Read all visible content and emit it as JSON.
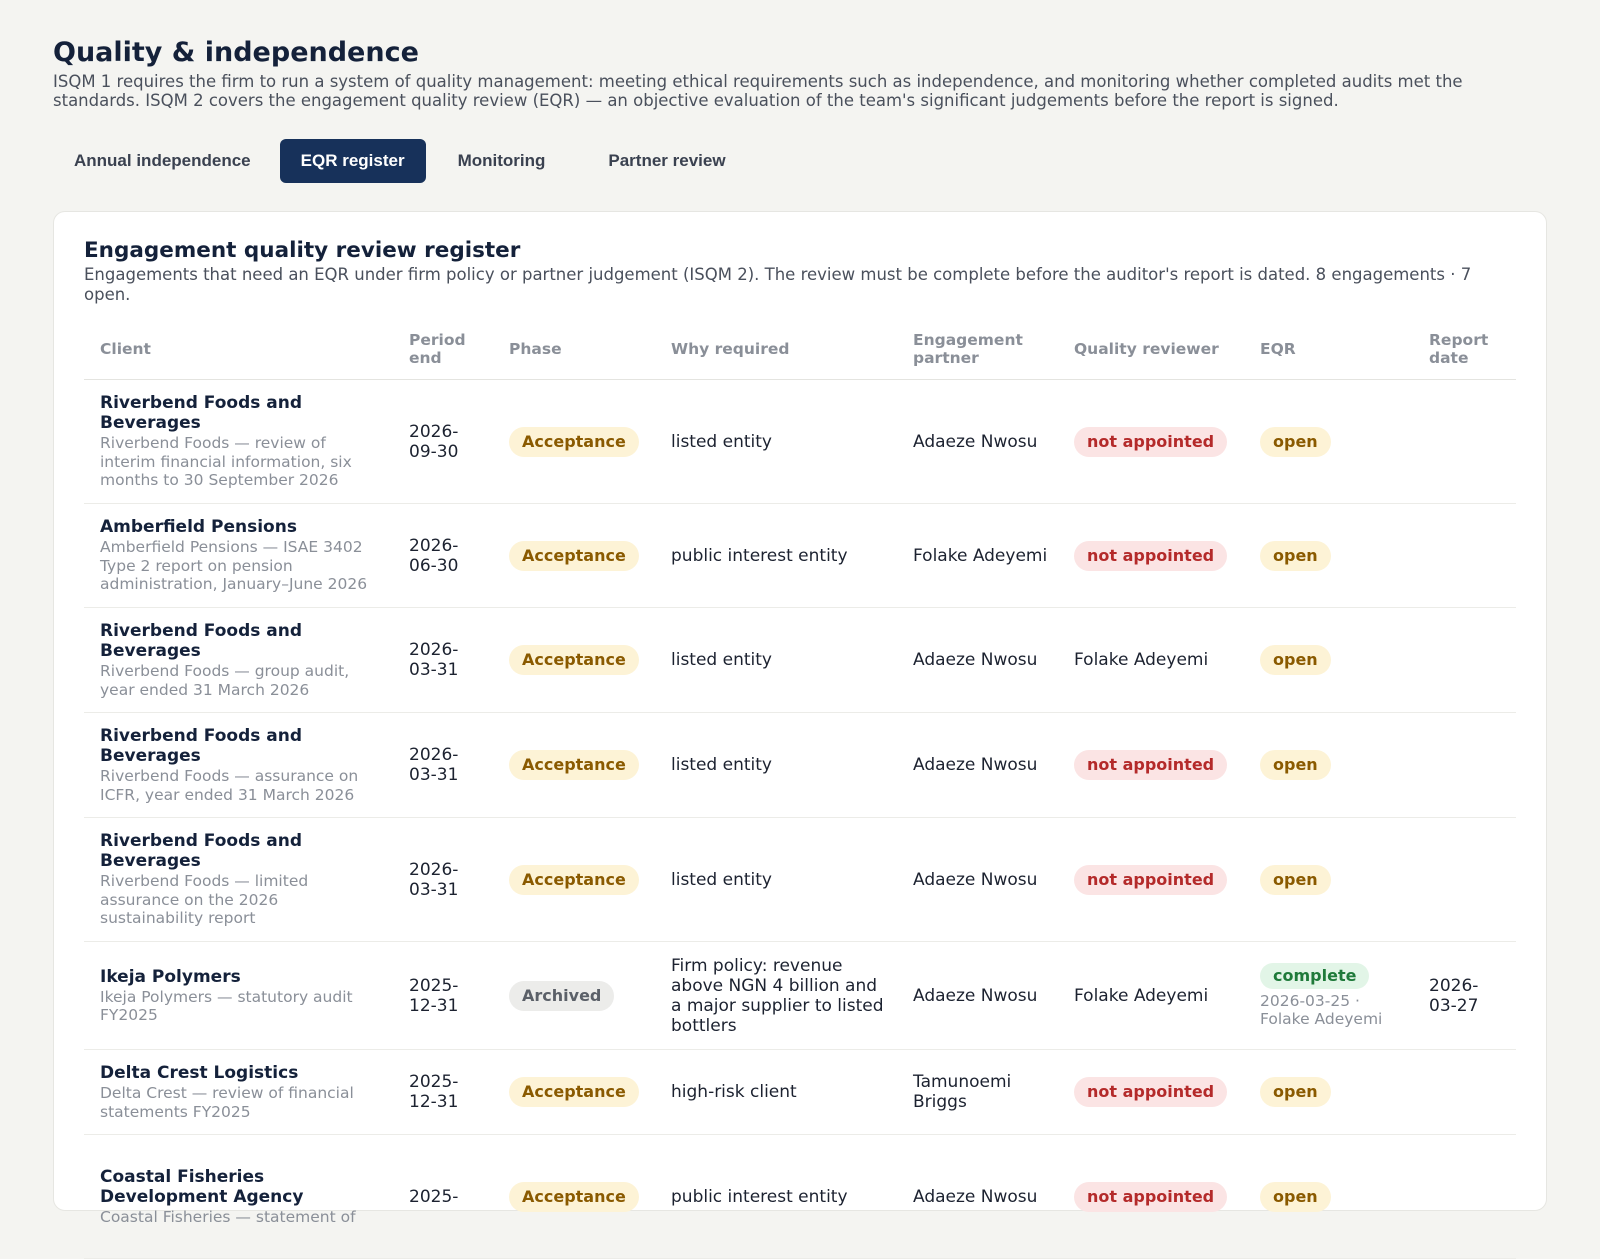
{
  "header": {
    "title": "Quality & independence",
    "description": "ISQM 1 requires the firm to run a system of quality management: meeting ethical requirements such as independence, and monitoring whether completed audits met the standards. ISQM 2 covers the engagement quality review (EQR) — an objective evaluation of the team's significant judgements before the report is signed."
  },
  "tabs": [
    {
      "label": "Annual independence",
      "active": false
    },
    {
      "label": "EQR register",
      "active": true
    },
    {
      "label": "Monitoring",
      "active": false
    },
    {
      "label": "Partner review",
      "active": false
    }
  ],
  "register": {
    "title": "Engagement quality review register",
    "description": "Engagements that need an EQR under firm policy or partner judgement (ISQM 2). The review must be complete before the auditor's report is dated. 8 engagements · 7 open.",
    "columns": [
      "Client",
      "Period end",
      "Phase",
      "Why required",
      "Engagement partner",
      "Quality reviewer",
      "EQR",
      "Report date"
    ],
    "rows": [
      {
        "client": "Riverbend Foods and Beverages",
        "engagement": "Riverbend Foods — review of interim financial information, six months to 30 September 2026",
        "period_end": "2026-09-30",
        "phase": "Acceptance",
        "why": "listed entity",
        "partner": "Adaeze Nwosu",
        "reviewer": "not appointed",
        "eqr": "open",
        "eqr_detail": "",
        "report_date": ""
      },
      {
        "client": "Amberfield Pensions",
        "engagement": "Amberfield Pensions — ISAE 3402 Type 2 report on pension administration, January–June 2026",
        "period_end": "2026-06-30",
        "phase": "Acceptance",
        "why": "public interest entity",
        "partner": "Folake Adeyemi",
        "reviewer": "not appointed",
        "eqr": "open",
        "eqr_detail": "",
        "report_date": ""
      },
      {
        "client": "Riverbend Foods and Beverages",
        "engagement": "Riverbend Foods — group audit, year ended 31 March 2026",
        "period_end": "2026-03-31",
        "phase": "Acceptance",
        "why": "listed entity",
        "partner": "Adaeze Nwosu",
        "reviewer": "Folake Adeyemi",
        "eqr": "open",
        "eqr_detail": "",
        "report_date": ""
      },
      {
        "client": "Riverbend Foods and Beverages",
        "engagement": "Riverbend Foods — assurance on ICFR, year ended 31 March 2026",
        "period_end": "2026-03-31",
        "phase": "Acceptance",
        "why": "listed entity",
        "partner": "Adaeze Nwosu",
        "reviewer": "not appointed",
        "eqr": "open",
        "eqr_detail": "",
        "report_date": ""
      },
      {
        "client": "Riverbend Foods and Beverages",
        "engagement": "Riverbend Foods — limited assurance on the 2026 sustainability report",
        "period_end": "2026-03-31",
        "phase": "Acceptance",
        "why": "listed entity",
        "partner": "Adaeze Nwosu",
        "reviewer": "not appointed",
        "eqr": "open",
        "eqr_detail": "",
        "report_date": ""
      },
      {
        "client": "Ikeja Polymers",
        "engagement": "Ikeja Polymers — statutory audit FY2025",
        "period_end": "2025-12-31",
        "phase": "Archived",
        "why": "Firm policy: revenue above NGN 4 billion and a major supplier to listed bottlers",
        "partner": "Adaeze Nwosu",
        "reviewer": "Folake Adeyemi",
        "eqr": "complete",
        "eqr_detail": "2026-03-25 · Folake Adeyemi",
        "report_date": "2026-03-27"
      },
      {
        "client": "Delta Crest Logistics",
        "engagement": "Delta Crest — review of financial statements FY2025",
        "period_end": "2025-12-31",
        "phase": "Acceptance",
        "why": "high-risk client",
        "partner": "Tamunoemi Briggs",
        "reviewer": "not appointed",
        "eqr": "open",
        "eqr_detail": "",
        "report_date": ""
      },
      {
        "client": "Coastal Fisheries Development Agency",
        "engagement": "Coastal Fisheries — statement of",
        "period_end": "2025-",
        "phase": "Acceptance",
        "why": "public interest entity",
        "partner": "Adaeze Nwosu",
        "reviewer": "not appointed",
        "eqr": "open",
        "eqr_detail": "",
        "report_date": ""
      }
    ]
  },
  "colors": {
    "accent": "#17315a",
    "phase_acceptance_bg": "#fdf3d6",
    "phase_archived_bg": "#ececea",
    "not_appointed": "#b42a2a",
    "complete": "#1f7a3a"
  }
}
